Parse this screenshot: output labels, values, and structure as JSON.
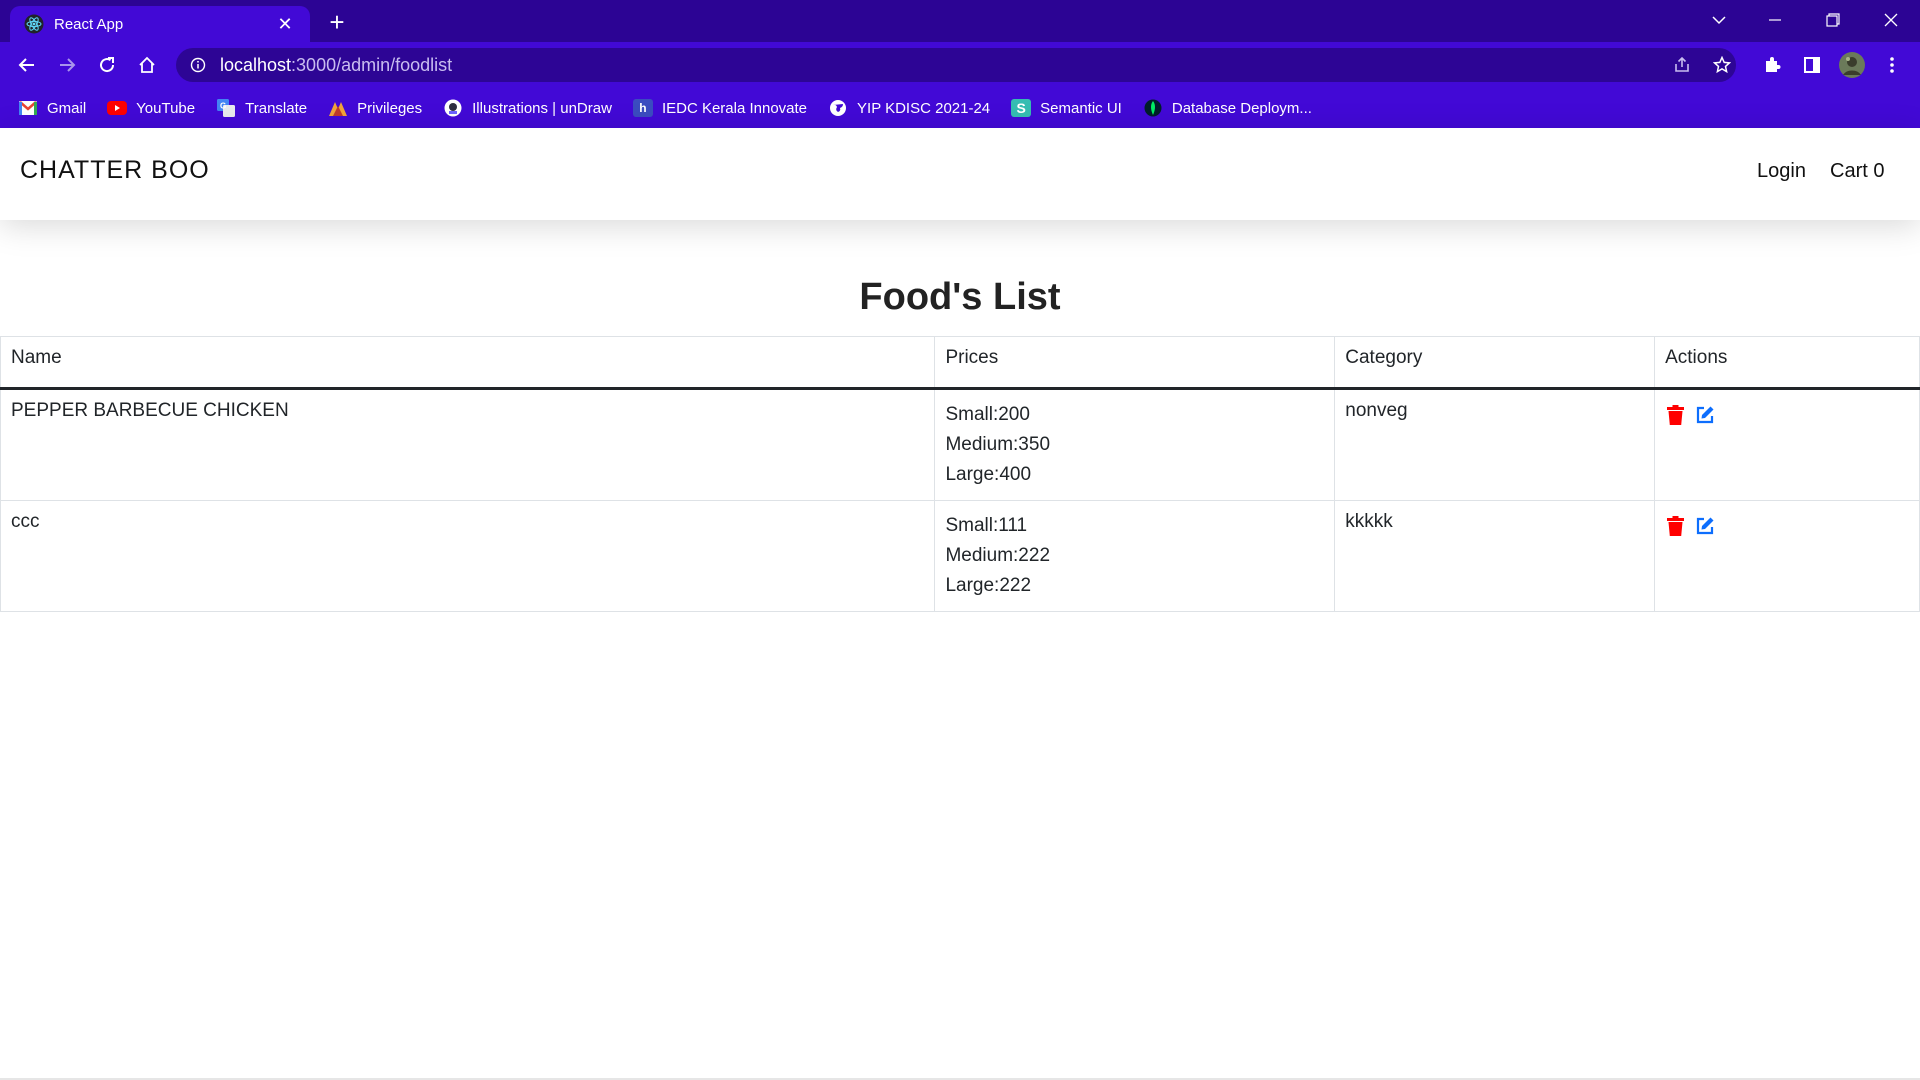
{
  "browser": {
    "tab_title": "React App",
    "url_host": "localhost",
    "url_rest": ":3000/admin/foodlist",
    "accent_color": "#4209d6",
    "tabstrip_color": "#2c0494",
    "bookmarks": [
      {
        "label": "Gmail",
        "icon": "gmail-icon"
      },
      {
        "label": "YouTube",
        "icon": "youtube-icon"
      },
      {
        "label": "Translate",
        "icon": "translate-icon"
      },
      {
        "label": "Privileges",
        "icon": "privileges-icon"
      },
      {
        "label": "Illustrations | unDraw",
        "icon": "undraw-icon"
      },
      {
        "label": "IEDC Kerala Innovate",
        "icon": "iedc-icon"
      },
      {
        "label": "YIP KDISC 2021-24",
        "icon": "globe-icon"
      },
      {
        "label": "Semantic UI",
        "icon": "semantic-ui-icon"
      },
      {
        "label": "Database Deploym...",
        "icon": "mongodb-icon"
      }
    ]
  },
  "navbar": {
    "brand": "CHATTER BOO",
    "login": "Login",
    "cart": "Cart 0"
  },
  "page": {
    "title": "Food's List"
  },
  "table": {
    "headers": [
      "Name",
      "Prices",
      "Category",
      "Actions"
    ],
    "rows": [
      {
        "name": "PEPPER BARBECUE CHICKEN",
        "prices": [
          "Small:200",
          "Medium:350",
          "Large:400"
        ],
        "category": "nonveg"
      },
      {
        "name": "ccc",
        "prices": [
          "Small:111",
          "Medium:222",
          "Large:222"
        ],
        "category": "kkkkk"
      }
    ],
    "delete_color": "#ff0000",
    "edit_color": "#0d6efd"
  }
}
